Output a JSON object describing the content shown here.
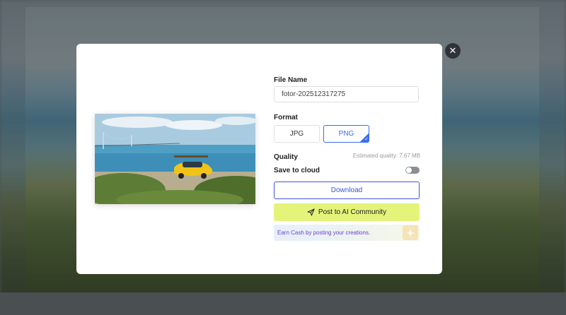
{
  "modal": {
    "close_icon": "close-icon",
    "file_name_label": "File Name",
    "file_name_value": "fotor-202512317275",
    "format_label": "Format",
    "formats": [
      {
        "label": "JPG",
        "selected": false
      },
      {
        "label": "PNG",
        "selected": true
      }
    ],
    "quality_label": "Quality",
    "quality_estimate": "Estimated quality: 7.67 MB",
    "save_to_cloud_label": "Save to cloud",
    "save_to_cloud_on": false,
    "download_label": "Download",
    "post_label": "Post to AI Community",
    "post_icon": "send-icon",
    "earn_text": "Earn Cash by posting your creations.",
    "earn_icon": "sparkle-icon"
  },
  "colors": {
    "accent_blue": "#3b6df0",
    "download_border": "#3b55d9",
    "post_bg": "#e4f47a",
    "earn_text": "#6b3fd4"
  }
}
